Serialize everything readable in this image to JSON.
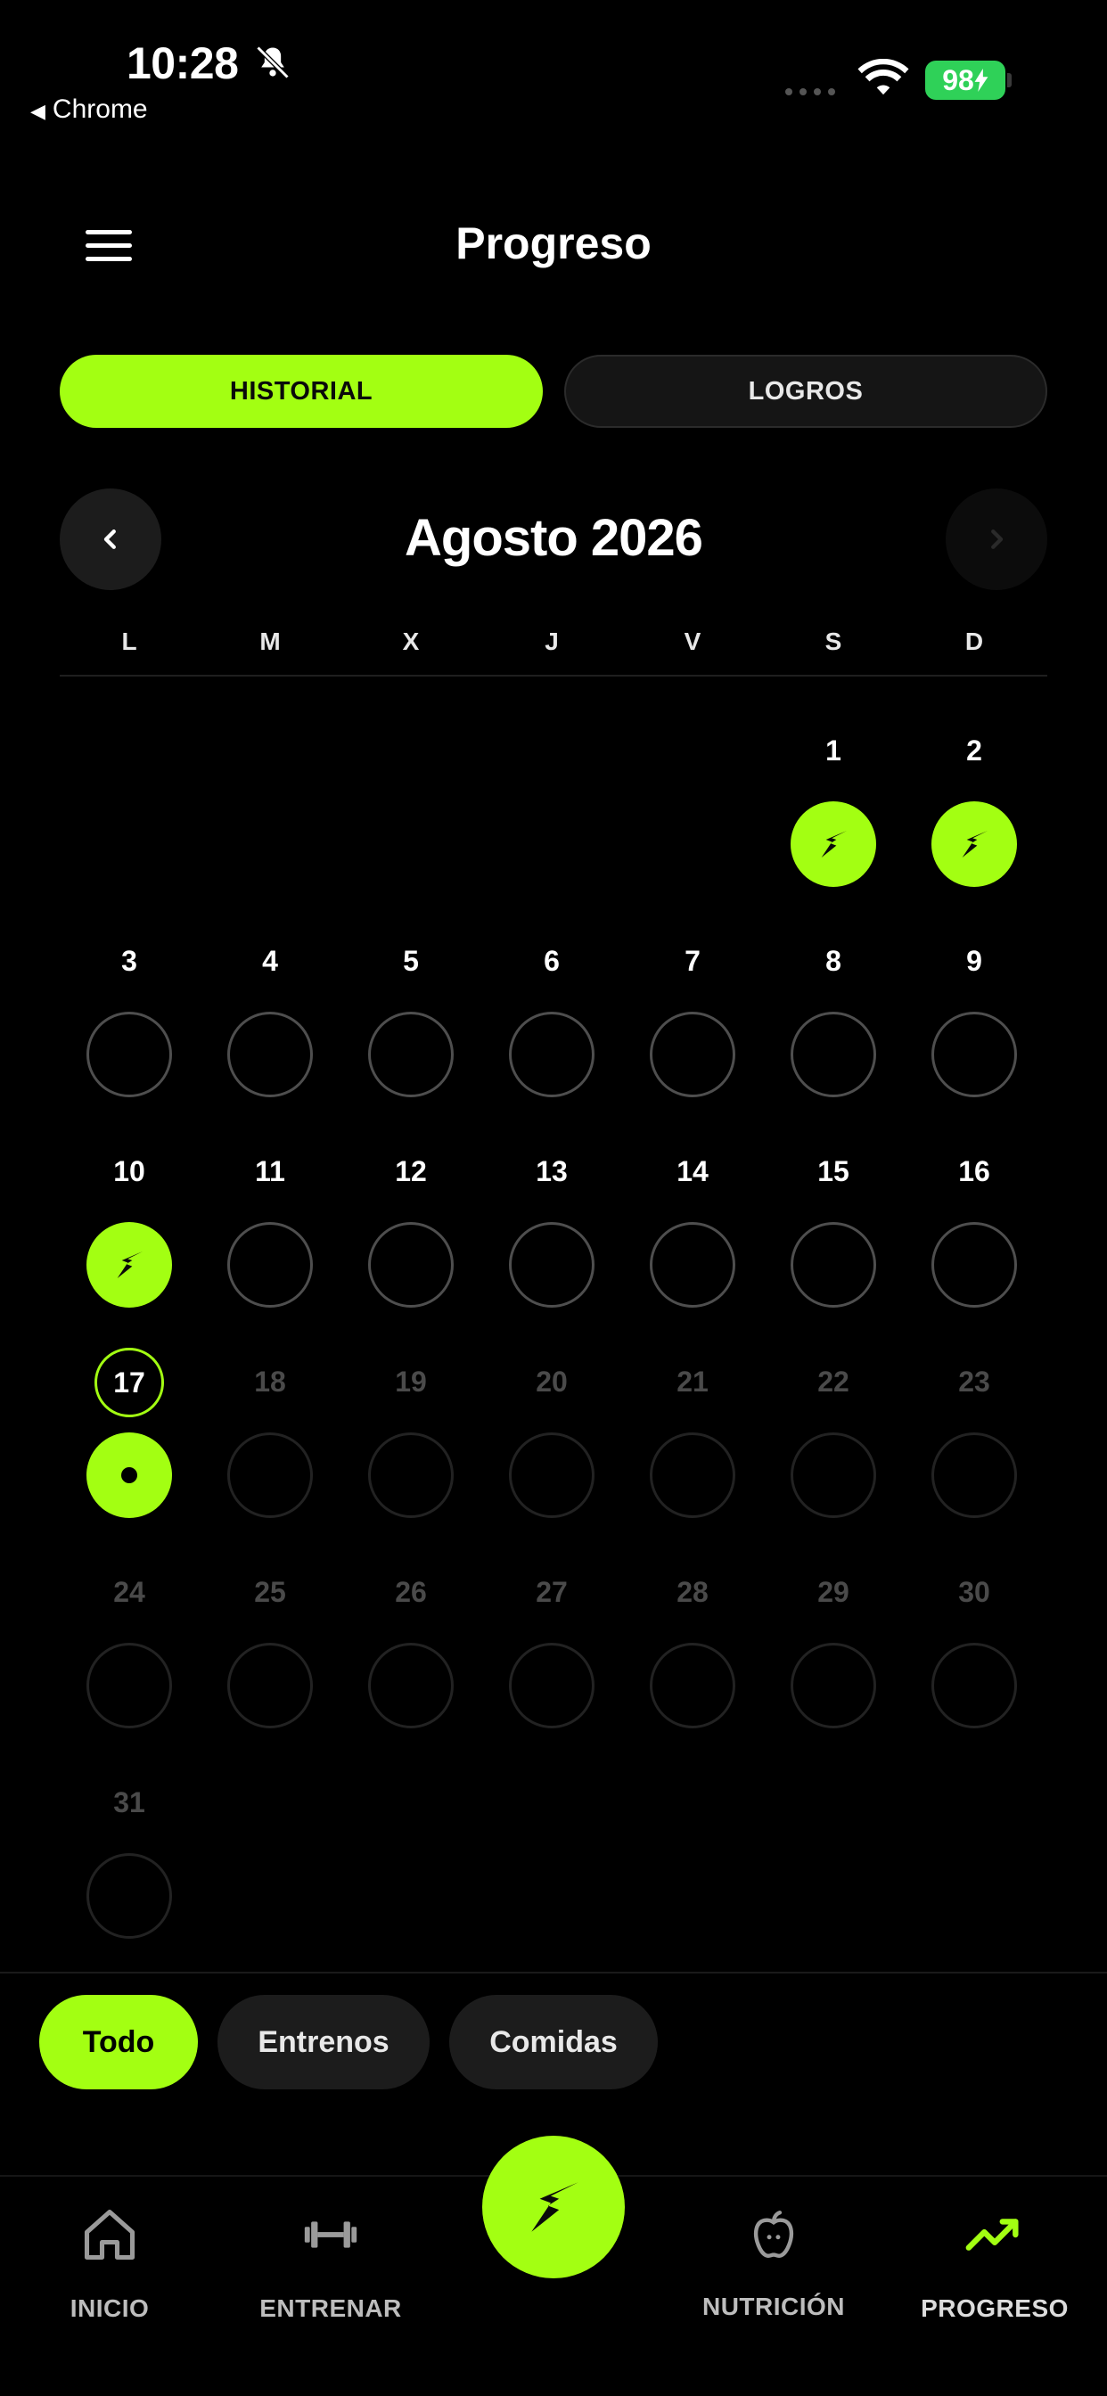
{
  "status_bar": {
    "time": "10:28",
    "back_app": "Chrome",
    "battery": "98"
  },
  "header": {
    "title": "Progreso"
  },
  "tabs": {
    "historial": "HISTORIAL",
    "logros": "LOGROS",
    "active": "historial"
  },
  "calendar": {
    "month_title": "Agosto 2026",
    "weekdays": [
      "L",
      "M",
      "X",
      "J",
      "V",
      "S",
      "D"
    ],
    "days": [
      {
        "n": "1",
        "state": "done"
      },
      {
        "n": "2",
        "state": "done"
      },
      {
        "n": "3",
        "state": "empty"
      },
      {
        "n": "4",
        "state": "empty"
      },
      {
        "n": "5",
        "state": "empty"
      },
      {
        "n": "6",
        "state": "empty"
      },
      {
        "n": "7",
        "state": "empty"
      },
      {
        "n": "8",
        "state": "empty"
      },
      {
        "n": "9",
        "state": "empty"
      },
      {
        "n": "10",
        "state": "done"
      },
      {
        "n": "11",
        "state": "empty"
      },
      {
        "n": "12",
        "state": "empty"
      },
      {
        "n": "13",
        "state": "empty"
      },
      {
        "n": "14",
        "state": "empty"
      },
      {
        "n": "15",
        "state": "empty"
      },
      {
        "n": "16",
        "state": "empty"
      },
      {
        "n": "17",
        "state": "today"
      },
      {
        "n": "18",
        "state": "future"
      },
      {
        "n": "19",
        "state": "future"
      },
      {
        "n": "20",
        "state": "future"
      },
      {
        "n": "21",
        "state": "future"
      },
      {
        "n": "22",
        "state": "future"
      },
      {
        "n": "23",
        "state": "future"
      },
      {
        "n": "24",
        "state": "future"
      },
      {
        "n": "25",
        "state": "future"
      },
      {
        "n": "26",
        "state": "future"
      },
      {
        "n": "27",
        "state": "future"
      },
      {
        "n": "28",
        "state": "future"
      },
      {
        "n": "29",
        "state": "future"
      },
      {
        "n": "30",
        "state": "future"
      },
      {
        "n": "31",
        "state": "future"
      }
    ]
  },
  "filters": {
    "todo": "Todo",
    "entrenos": "Entrenos",
    "comidas": "Comidas",
    "active": "todo"
  },
  "tabbar": {
    "inicio": "INICIO",
    "entrenar": "ENTRENAR",
    "nutricion": "NUTRICIÓN",
    "progreso": "PROGRESO",
    "active": "progreso"
  },
  "colors": {
    "accent": "#a3ff12",
    "background": "#000000",
    "battery": "#2fd158"
  },
  "icons": [
    "bell-off-icon",
    "wifi-icon",
    "menu-icon",
    "chevron-left-icon",
    "chevron-right-icon",
    "bolt-logo-icon",
    "home-icon",
    "dumbbell-icon",
    "apple-icon",
    "trending-up-icon"
  ]
}
